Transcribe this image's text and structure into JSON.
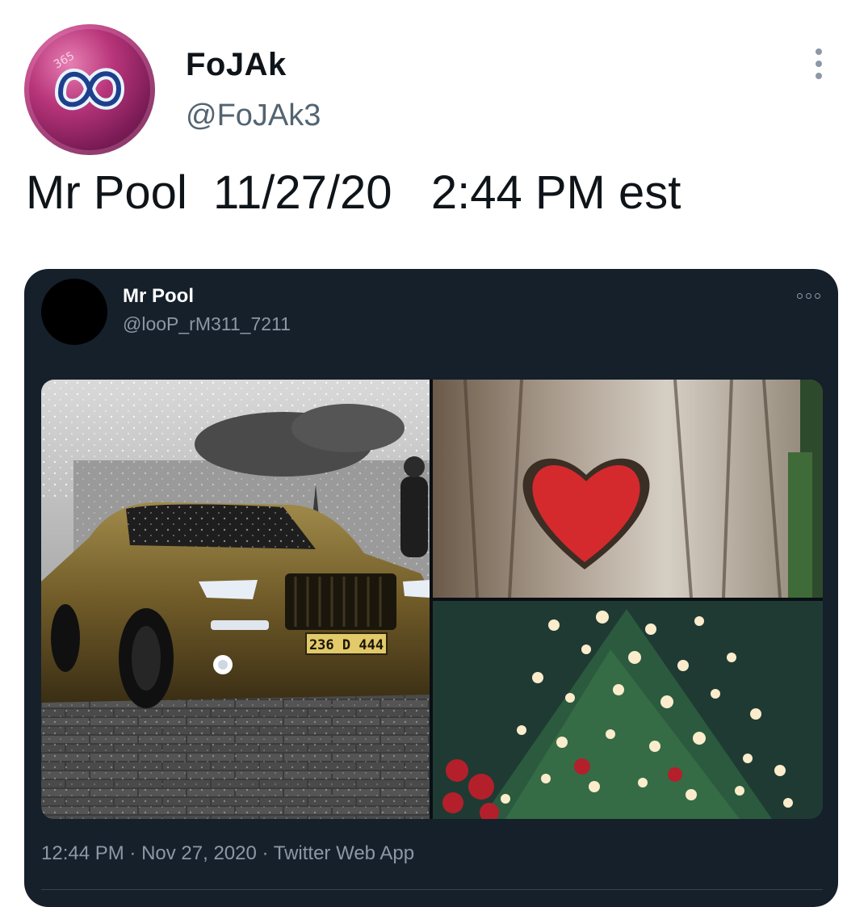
{
  "tweet": {
    "display_name": "FoJAk",
    "handle": "@FoJAk3",
    "text": "Mr Pool  11/27/20   2:44 PM est",
    "avatar_icon": "infinity-logo-icon",
    "more_icon": "vertical-ellipsis-icon"
  },
  "embedded_tweet": {
    "display_name": "Mr Pool",
    "handle": "@looP_rM311_7211",
    "more_icon": "horizontal-ellipsis-icon",
    "media": [
      {
        "name": "gold-car-photo",
        "plate_text": "236 D 444"
      },
      {
        "name": "heart-in-tree-bark-photo"
      },
      {
        "name": "christmas-tree-lights-photo"
      }
    ],
    "time": "12:44 PM",
    "separator": " · ",
    "date": "Nov 27, 2020",
    "source": "Twitter Web App"
  },
  "colors": {
    "embed_background": "#15202b",
    "secondary_text": "#8b98a5",
    "primary_text": "#0f1419",
    "heart_red": "#d42a2e",
    "car_gold": "#8a7236"
  }
}
